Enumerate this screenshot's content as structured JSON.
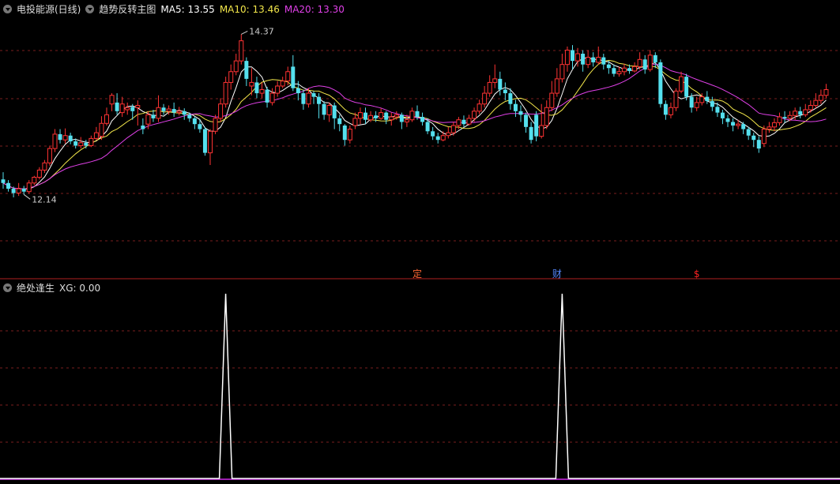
{
  "header": {
    "stock_title": "电投能源(日线)",
    "indicator_title": "趋势反转主图",
    "ma5_label": "MA5: 13.55",
    "ma10_label": "MA10: 13.46",
    "ma20_label": "MA20: 13.30"
  },
  "lower_header": {
    "title": "绝处逢生",
    "xg_label": "XG: 0.00"
  },
  "markers": [
    {
      "text": "定",
      "index": 80,
      "color": "#ff6633"
    },
    {
      "text": "财",
      "index": 107,
      "color": "#5588ff"
    },
    {
      "text": "$",
      "index": 134,
      "color": "#ff2222"
    }
  ],
  "colors": {
    "up": "#ff3333",
    "down": "#55e0ee",
    "ma5": "#ffffff",
    "ma10": "#f2e64a",
    "ma20": "#e040e8",
    "grid": "#7a1e1e",
    "divider": "#b02020",
    "xg": "#ffffff"
  },
  "chart_data": [
    {
      "type": "candlestick",
      "annotations": [
        {
          "text": "14.37",
          "index": 46,
          "value": 14.37
        },
        {
          "text": "12.14",
          "index": 4,
          "value": 12.14
        }
      ],
      "ylim": [
        11.55,
        14.65
      ],
      "candles": [
        [
          12.35,
          12.3,
          12.45,
          12.22
        ],
        [
          12.3,
          12.22,
          12.34,
          12.18
        ],
        [
          12.22,
          12.16,
          12.25,
          12.1
        ],
        [
          12.16,
          12.22,
          12.3,
          12.12
        ],
        [
          12.22,
          12.18,
          12.26,
          12.14
        ],
        [
          12.18,
          12.3,
          12.34,
          12.15
        ],
        [
          12.3,
          12.38,
          12.4,
          12.27
        ],
        [
          12.38,
          12.48,
          12.52,
          12.35
        ],
        [
          12.48,
          12.58,
          12.62,
          12.44
        ],
        [
          12.58,
          12.78,
          12.82,
          12.54
        ],
        [
          12.78,
          12.98,
          13.05,
          12.73
        ],
        [
          12.98,
          12.9,
          13.05,
          12.85
        ],
        [
          12.9,
          12.96,
          13.06,
          12.85
        ],
        [
          12.96,
          12.88,
          13.0,
          12.84
        ],
        [
          12.88,
          12.82,
          12.92,
          12.78
        ],
        [
          12.82,
          12.86,
          12.94,
          12.78
        ],
        [
          12.86,
          12.82,
          12.9,
          12.78
        ],
        [
          12.82,
          12.92,
          12.96,
          12.8
        ],
        [
          12.92,
          13.0,
          13.08,
          12.9
        ],
        [
          12.95,
          13.13,
          13.23,
          12.9
        ],
        [
          13.13,
          13.25,
          13.35,
          13.1
        ],
        [
          13.4,
          13.52,
          13.55,
          13.3
        ],
        [
          13.42,
          13.3,
          13.55,
          13.25
        ],
        [
          13.28,
          13.4,
          13.5,
          13.22
        ],
        [
          13.32,
          13.35,
          13.42,
          13.25
        ],
        [
          13.36,
          13.3,
          13.4,
          13.18
        ],
        [
          13.35,
          13.38,
          13.45,
          13.1
        ],
        [
          13.1,
          13.05,
          13.2,
          12.98
        ],
        [
          13.12,
          13.25,
          13.3,
          13.05
        ],
        [
          13.25,
          13.2,
          13.32,
          13.15
        ],
        [
          13.2,
          13.35,
          13.52,
          13.15
        ],
        [
          13.35,
          13.3,
          13.4,
          13.25
        ],
        [
          13.3,
          13.33,
          13.38,
          13.25
        ],
        [
          13.33,
          13.28,
          13.42,
          13.22
        ],
        [
          13.28,
          13.3,
          13.36,
          13.24
        ],
        [
          13.3,
          13.25,
          13.34,
          13.18
        ],
        [
          13.25,
          13.2,
          13.28,
          13.15
        ],
        [
          13.2,
          13.12,
          13.22,
          13.05
        ],
        [
          13.12,
          13.05,
          13.18,
          13.0
        ],
        [
          13.05,
          12.72,
          13.08,
          12.68
        ],
        [
          12.72,
          13.02,
          13.05,
          12.55
        ],
        [
          13.02,
          13.2,
          13.25,
          12.98
        ],
        [
          13.2,
          13.4,
          13.48,
          13.15
        ],
        [
          13.4,
          13.7,
          13.78,
          13.35
        ],
        [
          13.7,
          13.85,
          13.95,
          13.6
        ],
        [
          13.85,
          14.0,
          14.1,
          13.8
        ],
        [
          14.0,
          14.28,
          14.37,
          13.95
        ],
        [
          14.0,
          13.75,
          14.05,
          13.65
        ],
        [
          13.65,
          13.7,
          13.9,
          13.52
        ],
        [
          13.7,
          13.55,
          13.78,
          13.48
        ],
        [
          13.55,
          13.6,
          13.7,
          13.48
        ],
        [
          13.6,
          13.42,
          13.64,
          13.35
        ],
        [
          13.42,
          13.55,
          13.62,
          13.38
        ],
        [
          13.55,
          13.65,
          13.72,
          13.5
        ],
        [
          13.65,
          13.72,
          13.78,
          13.62
        ],
        [
          13.72,
          13.85,
          13.92,
          13.66
        ],
        [
          13.92,
          13.62,
          14.08,
          13.58
        ],
        [
          13.62,
          13.55,
          13.72,
          13.45
        ],
        [
          13.55,
          13.4,
          13.6,
          13.32
        ],
        [
          13.4,
          13.55,
          13.62,
          13.35
        ],
        [
          13.55,
          13.5,
          13.58,
          13.4
        ],
        [
          13.5,
          13.4,
          13.55,
          13.2
        ],
        [
          13.4,
          13.25,
          13.44,
          13.18
        ],
        [
          13.25,
          13.38,
          13.42,
          13.15
        ],
        [
          13.38,
          13.2,
          13.42,
          13.05
        ],
        [
          13.2,
          13.12,
          13.25,
          13.02
        ],
        [
          13.1,
          12.9,
          13.12,
          12.82
        ],
        [
          12.9,
          13.05,
          13.1,
          12.85
        ],
        [
          13.1,
          13.2,
          13.28,
          13.05
        ],
        [
          13.2,
          13.28,
          13.35,
          13.12
        ],
        [
          13.28,
          13.18,
          13.35,
          13.12
        ],
        [
          13.18,
          13.24,
          13.3,
          13.15
        ],
        [
          13.24,
          13.2,
          13.3,
          13.15
        ],
        [
          13.2,
          13.28,
          13.34,
          13.18
        ],
        [
          13.28,
          13.18,
          13.3,
          13.12
        ],
        [
          13.18,
          13.22,
          13.28,
          13.1
        ],
        [
          13.22,
          13.25,
          13.3,
          13.18
        ],
        [
          13.25,
          13.15,
          13.28,
          13.05
        ],
        [
          13.15,
          13.18,
          13.25,
          13.08
        ],
        [
          13.18,
          13.3,
          13.35,
          13.15
        ],
        [
          13.3,
          13.22,
          13.38,
          13.18
        ],
        [
          13.22,
          13.15,
          13.28,
          13.1
        ],
        [
          13.15,
          13.02,
          13.2,
          12.98
        ],
        [
          13.02,
          12.95,
          13.08,
          12.9
        ],
        [
          12.95,
          12.9,
          13.0,
          12.85
        ],
        [
          12.9,
          12.96,
          13.02,
          12.88
        ],
        [
          12.96,
          13.0,
          13.08,
          12.92
        ],
        [
          13.0,
          13.1,
          13.15,
          12.96
        ],
        [
          13.1,
          13.18,
          13.22,
          13.05
        ],
        [
          13.18,
          13.12,
          13.24,
          13.08
        ],
        [
          13.12,
          13.2,
          13.25,
          13.1
        ],
        [
          13.2,
          13.3,
          13.35,
          13.15
        ],
        [
          13.3,
          13.4,
          13.46,
          13.26
        ],
        [
          13.4,
          13.55,
          13.65,
          13.35
        ],
        [
          13.55,
          13.7,
          13.8,
          13.5
        ],
        [
          13.7,
          13.75,
          13.95,
          13.62
        ],
        [
          13.75,
          13.6,
          13.85,
          13.52
        ],
        [
          13.6,
          13.55,
          13.7,
          13.45
        ],
        [
          13.55,
          13.4,
          13.62,
          13.32
        ],
        [
          13.4,
          13.3,
          13.46,
          13.22
        ],
        [
          13.3,
          13.25,
          13.38,
          13.15
        ],
        [
          13.25,
          13.08,
          13.28,
          13.0
        ],
        [
          13.08,
          12.9,
          13.15,
          12.85
        ],
        [
          13.25,
          12.95,
          13.3,
          12.88
        ],
        [
          12.95,
          13.1,
          13.4,
          12.92
        ],
        [
          13.1,
          13.35,
          13.45,
          13.05
        ],
        [
          13.35,
          13.55,
          13.72,
          13.3
        ],
        [
          13.55,
          13.75,
          13.9,
          13.5
        ],
        [
          13.75,
          13.95,
          14.1,
          13.7
        ],
        [
          13.95,
          14.15,
          14.2,
          13.85
        ],
        [
          14.15,
          14.0,
          14.22,
          13.88
        ],
        [
          14.0,
          14.1,
          14.18,
          13.92
        ],
        [
          14.1,
          13.95,
          14.15,
          13.85
        ],
        [
          13.95,
          14.05,
          14.15,
          13.9
        ],
        [
          14.05,
          13.98,
          14.12,
          13.92
        ],
        [
          13.98,
          14.05,
          14.2,
          13.95
        ],
        [
          14.05,
          13.95,
          14.1,
          13.88
        ],
        [
          13.95,
          13.9,
          14.0,
          13.82
        ],
        [
          13.9,
          13.82,
          13.95,
          13.78
        ],
        [
          13.82,
          13.85,
          13.92,
          13.78
        ],
        [
          13.85,
          13.9,
          13.96,
          13.8
        ],
        [
          13.9,
          13.86,
          13.95,
          13.82
        ],
        [
          13.86,
          13.92,
          13.98,
          13.84
        ],
        [
          13.92,
          14.02,
          14.12,
          13.88
        ],
        [
          14.02,
          13.88,
          14.08,
          13.82
        ],
        [
          13.88,
          14.08,
          14.15,
          13.85
        ],
        [
          14.08,
          13.98,
          14.12,
          13.9
        ],
        [
          13.98,
          13.4,
          14.02,
          13.35
        ],
        [
          13.4,
          13.25,
          13.45,
          13.18
        ],
        [
          13.25,
          13.35,
          13.42,
          13.2
        ],
        [
          13.35,
          13.58,
          13.62,
          13.3
        ],
        [
          13.58,
          13.78,
          13.85,
          13.55
        ],
        [
          13.78,
          13.5,
          13.82,
          13.45
        ],
        [
          13.5,
          13.35,
          13.55,
          13.28
        ],
        [
          13.35,
          13.42,
          13.5,
          13.3
        ],
        [
          13.42,
          13.5,
          13.55,
          13.38
        ],
        [
          13.5,
          13.44,
          13.58,
          13.4
        ],
        [
          13.44,
          13.36,
          13.5,
          13.3
        ],
        [
          13.36,
          13.28,
          13.42,
          13.22
        ],
        [
          13.28,
          13.2,
          13.32,
          13.12
        ],
        [
          13.2,
          13.15,
          13.25,
          13.08
        ],
        [
          13.15,
          13.1,
          13.2,
          13.02
        ],
        [
          13.1,
          13.12,
          13.18,
          13.05
        ],
        [
          13.12,
          13.05,
          13.15,
          12.98
        ],
        [
          13.05,
          12.96,
          13.08,
          12.9
        ],
        [
          12.96,
          12.9,
          13.0,
          12.8
        ],
        [
          12.9,
          12.78,
          12.95,
          12.72
        ],
        [
          12.85,
          13.05,
          13.1,
          12.8
        ],
        [
          13.05,
          13.08,
          13.15,
          13.0
        ],
        [
          13.08,
          13.14,
          13.2,
          13.02
        ],
        [
          13.14,
          13.22,
          13.28,
          13.1
        ],
        [
          13.22,
          13.2,
          13.3,
          13.14
        ],
        [
          13.2,
          13.24,
          13.3,
          13.16
        ],
        [
          13.24,
          13.3,
          13.35,
          13.18
        ],
        [
          13.3,
          13.25,
          13.36,
          13.2
        ],
        [
          13.25,
          13.32,
          13.4,
          13.22
        ],
        [
          13.32,
          13.38,
          13.45,
          13.28
        ],
        [
          13.38,
          13.45,
          13.55,
          13.34
        ],
        [
          13.45,
          13.52,
          13.6,
          13.4
        ],
        [
          13.52,
          13.6,
          13.68,
          13.48
        ]
      ]
    },
    {
      "type": "line",
      "title": "XG",
      "ylim": [
        0,
        1
      ],
      "spikes_at": [
        43,
        108
      ],
      "values_default": 0
    }
  ]
}
